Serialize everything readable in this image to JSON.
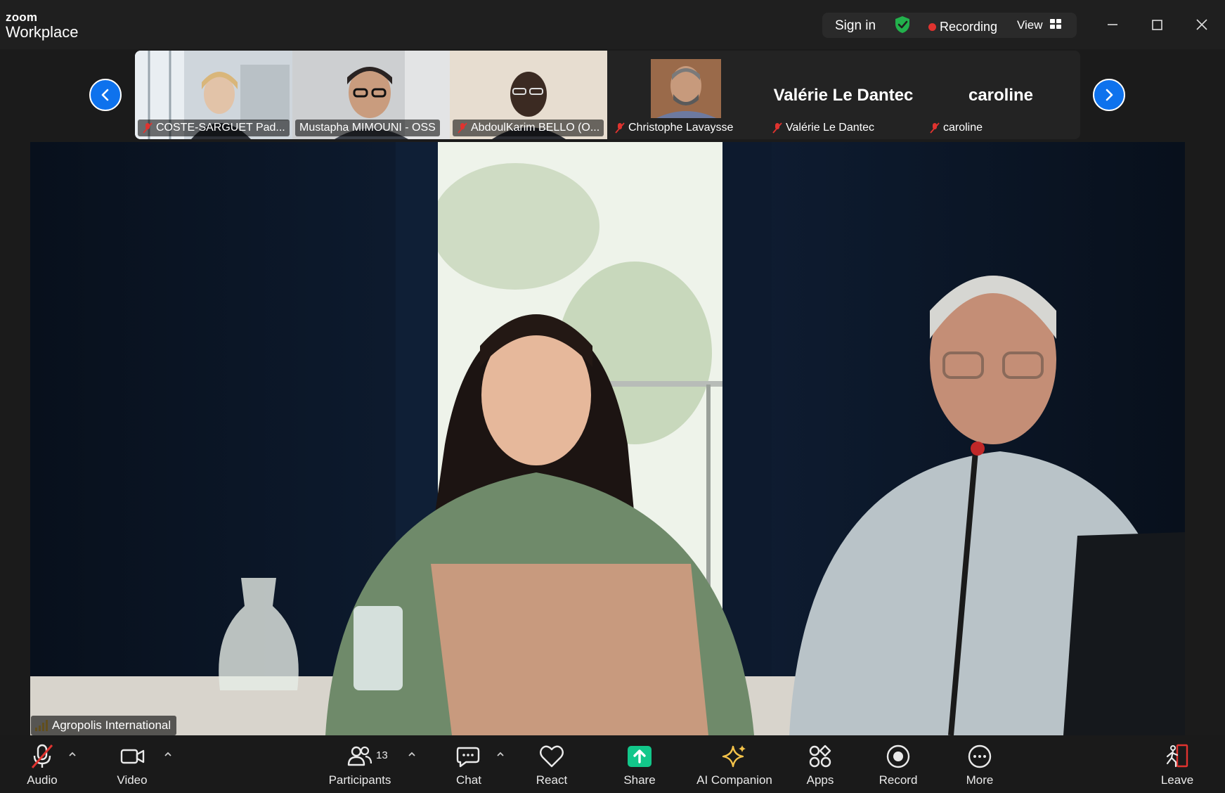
{
  "app": {
    "brand_small": "zoom",
    "brand_large": "Workplace"
  },
  "titlebar": {
    "sign_in": "Sign in",
    "recording": "Recording",
    "view": "View",
    "secure_color": "#22b14c",
    "recording_color": "#e0332f"
  },
  "gallery": {
    "tiles": [
      {
        "name": "COSTE-SARGUET Pad...",
        "muted": true,
        "type": "video"
      },
      {
        "name": "Mustapha MIMOUNI - OSS",
        "muted": false,
        "type": "video"
      },
      {
        "name": "AbdoulKarim BELLO (O...",
        "muted": true,
        "type": "video"
      },
      {
        "name": "Christophe Lavaysse",
        "muted": true,
        "type": "photo"
      },
      {
        "name": "Valérie Le Dantec",
        "display": "Valérie Le Dantec",
        "muted": true,
        "type": "name"
      },
      {
        "name": "caroline",
        "display": "caroline",
        "muted": true,
        "type": "name"
      }
    ],
    "accent": "#0e72ed"
  },
  "stage": {
    "speaker": "Agropolis International"
  },
  "toolbar": {
    "audio": "Audio",
    "video": "Video",
    "participants": "Participants",
    "participants_count": "13",
    "chat": "Chat",
    "react": "React",
    "share": "Share",
    "ai_companion": "AI Companion",
    "apps": "Apps",
    "record": "Record",
    "more": "More",
    "leave": "Leave",
    "share_color": "#12c78a",
    "ai_color": "#f3c24a",
    "leave_color": "#e0332f"
  }
}
